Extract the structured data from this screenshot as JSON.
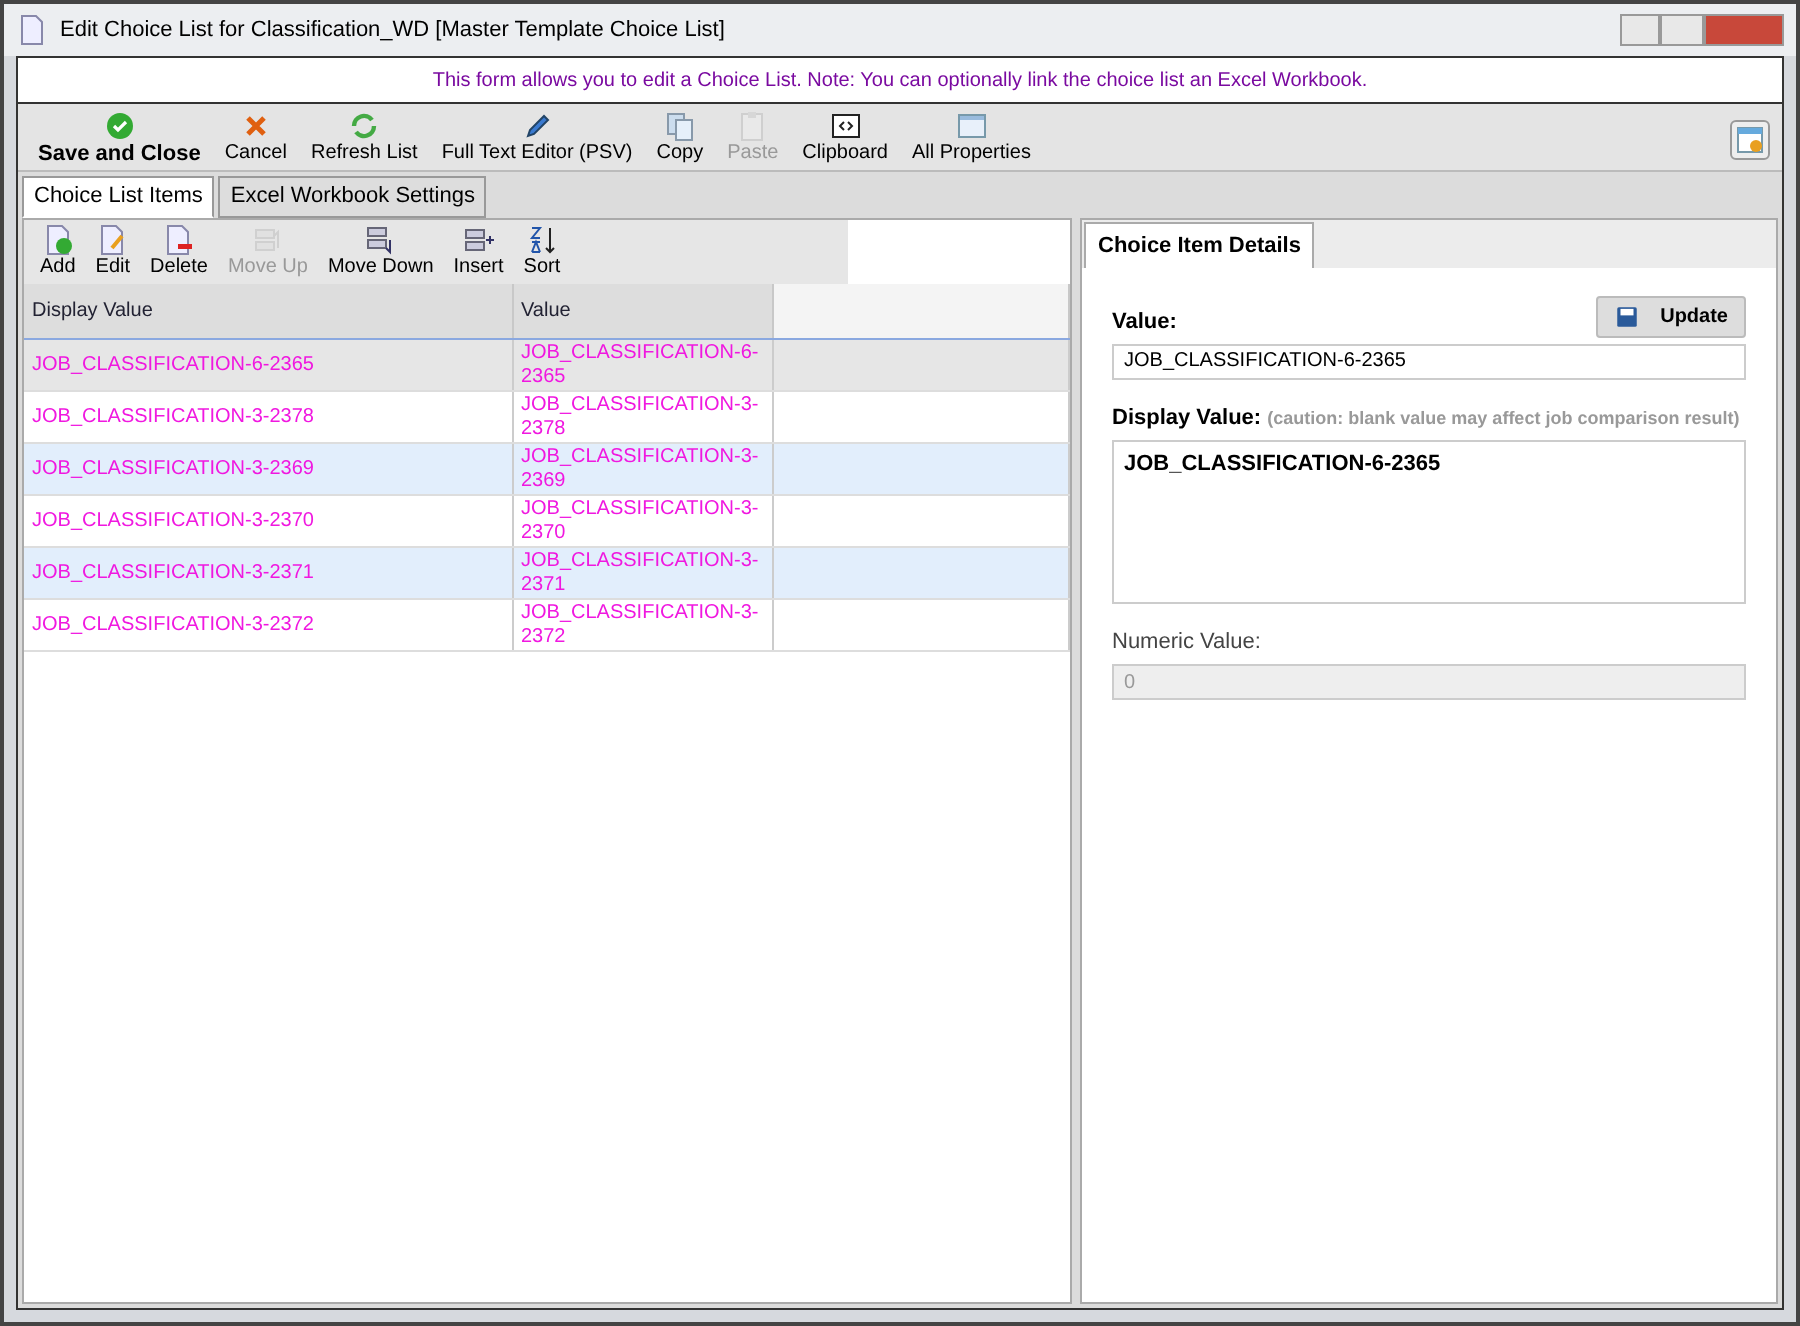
{
  "window": {
    "title": "Edit Choice List for Classification_WD [Master Template Choice List]"
  },
  "message": "This form allows you to edit a Choice List.  Note: You can optionally link the choice list an Excel Workbook.",
  "toolbar": [
    {
      "label": "Save and Close",
      "kind": "primary",
      "disabled": false
    },
    {
      "label": "Cancel",
      "kind": "normal",
      "disabled": false
    },
    {
      "label": "Refresh List",
      "kind": "normal",
      "disabled": false
    },
    {
      "label": "Full Text Editor (PSV)",
      "kind": "normal",
      "disabled": false
    },
    {
      "label": "Copy",
      "kind": "normal",
      "disabled": false
    },
    {
      "label": "Paste",
      "kind": "normal",
      "disabled": true
    },
    {
      "label": "Clipboard",
      "kind": "normal",
      "disabled": false
    },
    {
      "label": "All Properties",
      "kind": "normal",
      "disabled": false
    }
  ],
  "tabs": [
    {
      "label": "Choice List Items",
      "selected": true
    },
    {
      "label": "Excel Workbook Settings",
      "selected": false
    }
  ],
  "list_toolbar": [
    {
      "label": "Add",
      "disabled": false
    },
    {
      "label": "Edit",
      "disabled": false
    },
    {
      "label": "Delete",
      "disabled": false
    },
    {
      "label": "Move Up",
      "disabled": true
    },
    {
      "label": "Move Down",
      "disabled": false
    },
    {
      "label": "Insert",
      "disabled": false
    },
    {
      "label": "Sort",
      "disabled": false
    }
  ],
  "table": {
    "columns": [
      "Display Value",
      "Value"
    ],
    "rows": [
      {
        "display_value": "JOB_CLASSIFICATION-6-2365",
        "value": "JOB_CLASSIFICATION-6-2365",
        "selected": true
      },
      {
        "display_value": "JOB_CLASSIFICATION-3-2378",
        "value": "JOB_CLASSIFICATION-3-2378",
        "selected": false
      },
      {
        "display_value": "JOB_CLASSIFICATION-3-2369",
        "value": "JOB_CLASSIFICATION-3-2369",
        "selected": false
      },
      {
        "display_value": "JOB_CLASSIFICATION-3-2370",
        "value": "JOB_CLASSIFICATION-3-2370",
        "selected": false
      },
      {
        "display_value": "JOB_CLASSIFICATION-3-2371",
        "value": "JOB_CLASSIFICATION-3-2371",
        "selected": false
      },
      {
        "display_value": "JOB_CLASSIFICATION-3-2372",
        "value": "JOB_CLASSIFICATION-3-2372",
        "selected": false
      }
    ]
  },
  "details": {
    "tab": "Choice Item Details",
    "update_button": "Update",
    "value_label": "Value:",
    "value": "JOB_CLASSIFICATION-6-2365",
    "display_label": "Display Value:",
    "display_caution": "(caution: blank value may affect job comparison result)",
    "display_value": "JOB_CLASSIFICATION-6-2365",
    "numeric_label": "Numeric Value:",
    "numeric_value": "0"
  }
}
